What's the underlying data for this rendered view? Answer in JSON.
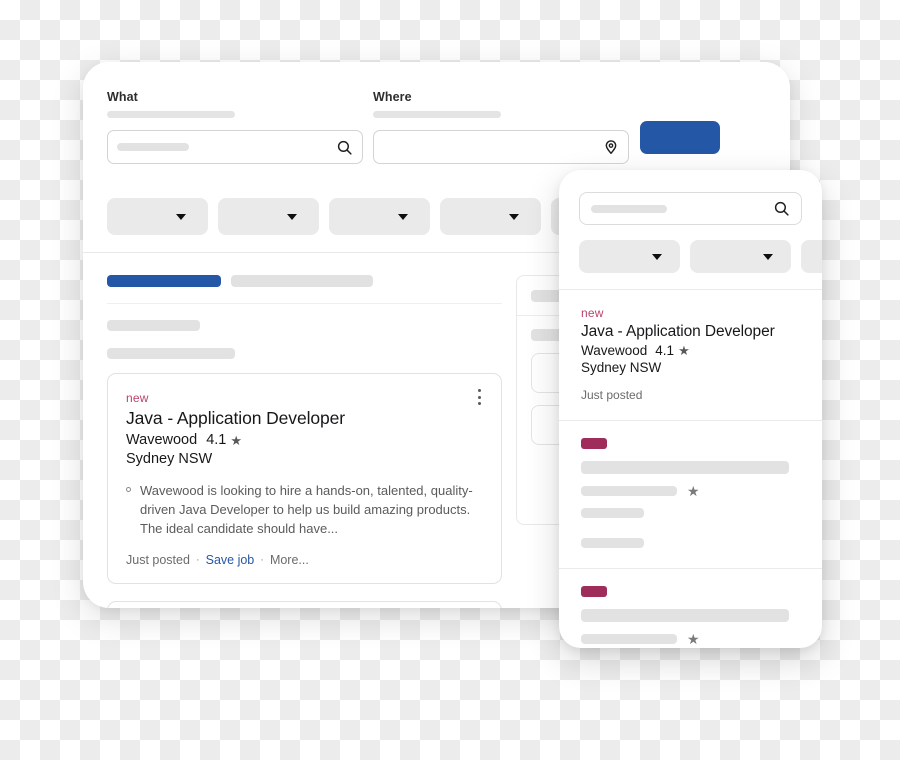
{
  "desktop": {
    "search": {
      "what_label": "What",
      "where_label": "Where",
      "what_placeholder": "",
      "where_placeholder": "",
      "search_icon": "search-icon",
      "location_icon": "map-pin-icon",
      "find_button_label": "",
      "find_button_color": "#2557a7"
    },
    "filters": [
      {
        "label": "",
        "caret": "chevron-down-icon"
      },
      {
        "label": "",
        "caret": "chevron-down-icon"
      },
      {
        "label": "",
        "caret": "chevron-down-icon"
      },
      {
        "label": "",
        "caret": "chevron-down-icon"
      },
      {
        "label": "",
        "caret": "chevron-down-icon"
      }
    ],
    "job_card": {
      "badge": "new",
      "title": "Java - Application Developer",
      "company": "Wavewood",
      "rating": "4.1",
      "star_icon": "star-icon",
      "location": "Sydney NSW",
      "snippet": "Wavewood is looking to hire a hands-on, talented, quality-driven Java Developer to help us build amazing products. The ideal candidate should have...",
      "posted": "Just posted",
      "save_label": "Save job",
      "more_label": "More...",
      "separator": "·",
      "menu_icon": "kebab-menu-icon"
    }
  },
  "mobile": {
    "search": {
      "placeholder": "",
      "search_icon": "search-icon"
    },
    "filters": [
      {
        "caret": "chevron-down-icon"
      },
      {
        "caret": "chevron-down-icon"
      },
      {
        "caret": "chevron-down-icon"
      }
    ],
    "job_card": {
      "badge": "new",
      "title": "Java - Application Developer",
      "company": "Wavewood",
      "rating": "4.1",
      "star_icon": "star-icon",
      "location": "Sydney NSW",
      "posted": "Just posted"
    }
  },
  "colors": {
    "accent_blue": "#2557a7",
    "badge_pink": "#b9446c",
    "badge_maroon": "#9e2d5b",
    "skeleton_grey": "#e2e2e2",
    "chip_grey": "#eaeaea"
  }
}
